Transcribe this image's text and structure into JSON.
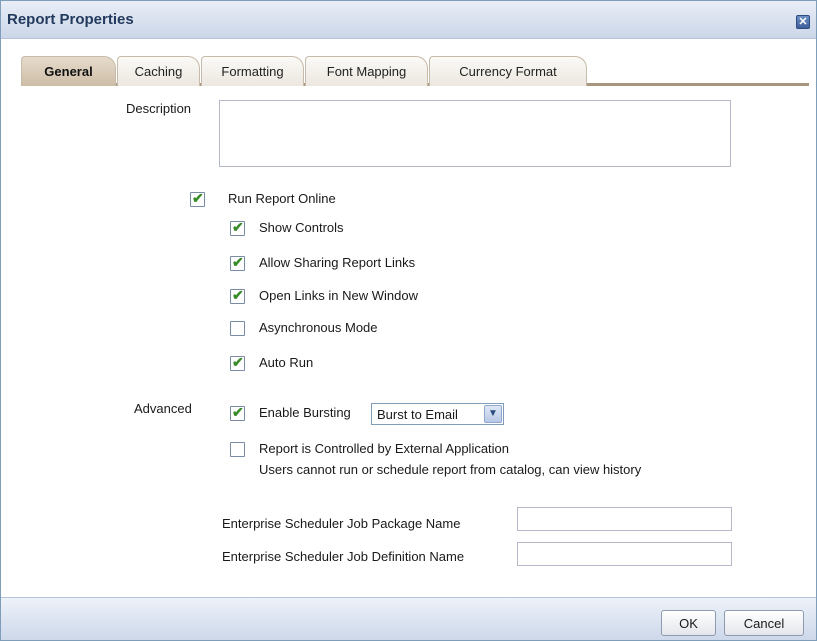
{
  "dialog": {
    "title": "Report Properties",
    "close_label": "✕"
  },
  "tabs": [
    {
      "label": "General",
      "active": true
    },
    {
      "label": "Caching",
      "active": false
    },
    {
      "label": "Formatting",
      "active": false
    },
    {
      "label": "Font Mapping",
      "active": false
    },
    {
      "label": "Currency Format",
      "active": false
    }
  ],
  "general": {
    "description_label": "Description",
    "description_value": "",
    "run_report_online": {
      "label": "Run Report Online",
      "checked": true
    },
    "show_controls": {
      "label": "Show Controls",
      "checked": true
    },
    "allow_sharing": {
      "label": "Allow Sharing Report Links",
      "checked": true
    },
    "open_links_new_window": {
      "label": "Open Links in New Window",
      "checked": true
    },
    "asynchronous_mode": {
      "label": "Asynchronous Mode",
      "checked": false
    },
    "auto_run": {
      "label": "Auto Run",
      "checked": true
    },
    "advanced_label": "Advanced",
    "enable_bursting": {
      "label": "Enable Bursting",
      "checked": true
    },
    "bursting_select_value": "Burst to Email",
    "external_app": {
      "label": "Report is Controlled by External Application",
      "checked": false
    },
    "external_app_note": "Users cannot run or schedule report from catalog, can view history",
    "job_package_label": "Enterprise Scheduler Job Package Name",
    "job_package_value": "",
    "job_definition_label": "Enterprise Scheduler Job Definition Name",
    "job_definition_value": ""
  },
  "footer": {
    "ok_label": "OK",
    "cancel_label": "Cancel"
  },
  "icons": {
    "checkmark": "✔",
    "dropdown_arrow": "▼"
  },
  "colors": {
    "check_green": "#3a8c2b",
    "active_tab": "#cdbda6",
    "tab_underline": "#a8957d"
  }
}
